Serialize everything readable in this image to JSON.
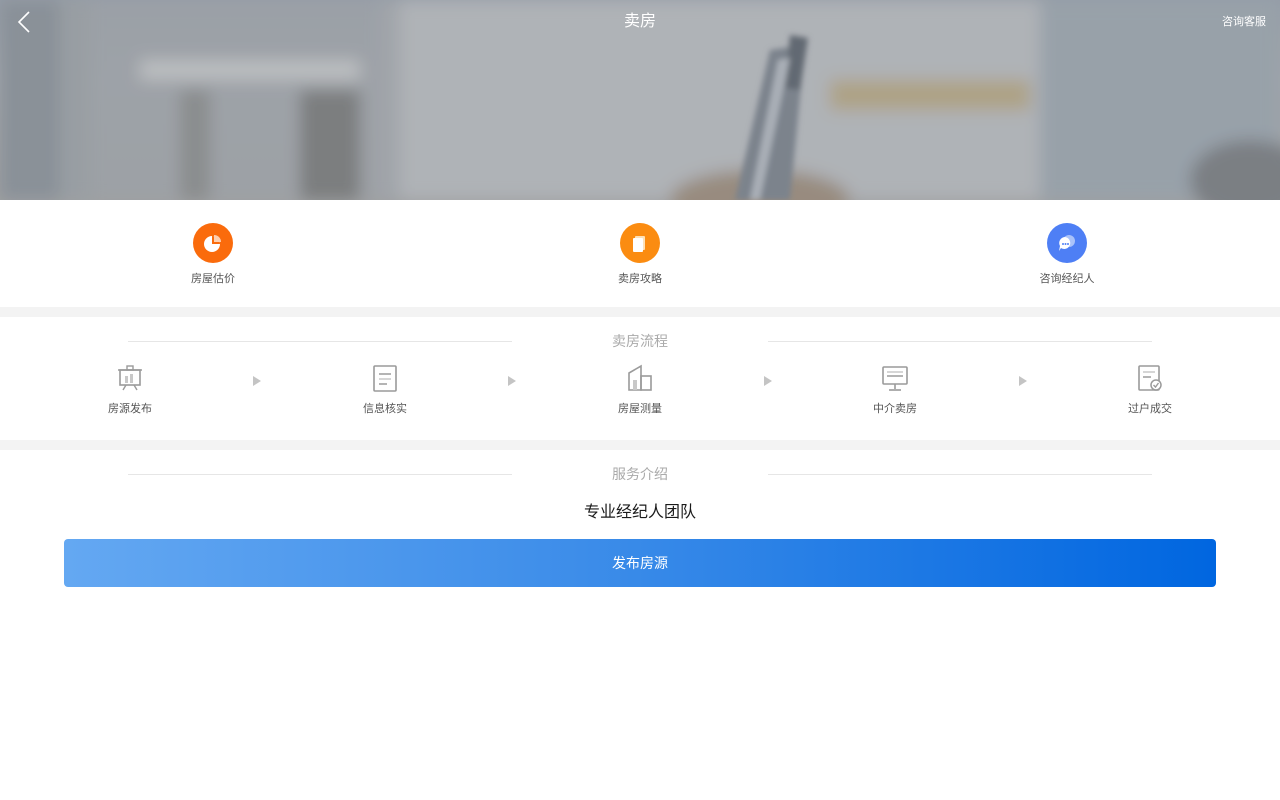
{
  "header": {
    "title": "卖房",
    "right_link": "咨询客服"
  },
  "quick_actions": [
    {
      "label": "房屋估价",
      "icon": "pie-chart-icon",
      "color": "#fa6b0c"
    },
    {
      "label": "卖房攻略",
      "icon": "guide-book-icon",
      "color": "#fb8c11"
    },
    {
      "label": "咨询经纪人",
      "icon": "chat-bubble-icon",
      "color": "#4e7ff5"
    }
  ],
  "process": {
    "title": "卖房流程",
    "steps": [
      {
        "label": "房源发布",
        "icon": "easel-board-icon"
      },
      {
        "label": "信息核实",
        "icon": "document-icon"
      },
      {
        "label": "房屋测量",
        "icon": "building-measure-icon"
      },
      {
        "label": "中介卖房",
        "icon": "monitor-icon"
      },
      {
        "label": "过户成交",
        "icon": "document-check-icon"
      }
    ]
  },
  "service": {
    "title": "服务介绍",
    "subtitle": "专业经纪人团队",
    "button_label": "发布房源"
  },
  "colors": {
    "accent_blue": "#0066e0",
    "icon_gray": "#9a9a9a"
  }
}
